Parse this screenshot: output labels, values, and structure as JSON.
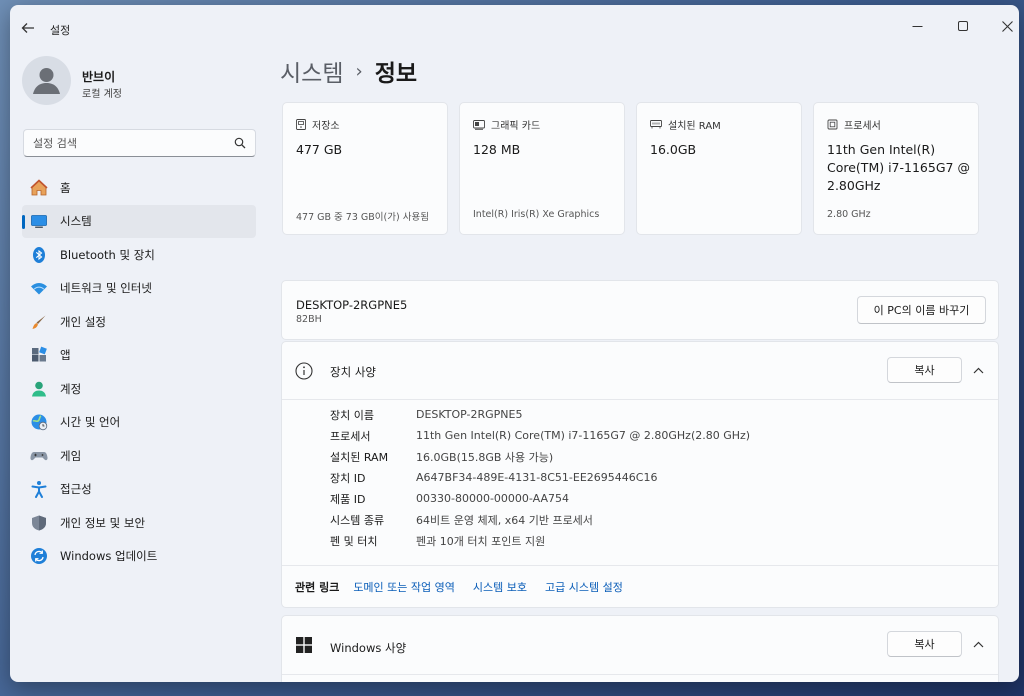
{
  "window": {
    "app_title": "설정"
  },
  "profile": {
    "name": "반브이",
    "account_type": "로컬 계정"
  },
  "search": {
    "placeholder": "설정 검색"
  },
  "nav": {
    "items": [
      {
        "label": "홈",
        "icon": "home-icon"
      },
      {
        "label": "시스템",
        "icon": "system-icon",
        "active": true
      },
      {
        "label": "Bluetooth 및 장치",
        "icon": "bluetooth-icon"
      },
      {
        "label": "네트워크 및 인터넷",
        "icon": "network-icon"
      },
      {
        "label": "개인 설정",
        "icon": "brush-icon"
      },
      {
        "label": "앱",
        "icon": "apps-icon"
      },
      {
        "label": "계정",
        "icon": "account-icon"
      },
      {
        "label": "시간 및 언어",
        "icon": "time-language-icon"
      },
      {
        "label": "게임",
        "icon": "gamepad-icon"
      },
      {
        "label": "접근성",
        "icon": "accessibility-icon"
      },
      {
        "label": "개인 정보 및 보안",
        "icon": "shield-icon"
      },
      {
        "label": "Windows 업데이트",
        "icon": "update-icon"
      }
    ]
  },
  "breadcrumb": {
    "parent": "시스템",
    "separator": "›",
    "current": "정보"
  },
  "cards": [
    {
      "label": "저장소",
      "value": "477 GB",
      "footer": "477 GB 중 73 GB이(가) 사용됨",
      "icon": "storage-icon"
    },
    {
      "label": "그래픽 카드",
      "value": "128 MB",
      "footer": "Intel(R) Iris(R) Xe Graphics",
      "icon": "graphics-card-icon"
    },
    {
      "label": "설치된 RAM",
      "value": "16.0GB",
      "footer": "",
      "icon": "ram-icon"
    },
    {
      "label": "프로세서",
      "value": "11th Gen Intel(R) Core(TM) i7-1165G7 @ 2.80GHz",
      "footer": "2.80 GHz",
      "icon": "processor-icon"
    }
  ],
  "pc": {
    "name": "DESKTOP-2RGPNE5",
    "model": "82BH",
    "rename_label": "이 PC의 이름 바꾸기"
  },
  "device_specs": {
    "title": "장치 사양",
    "copy_label": "복사",
    "rows": [
      {
        "label": "장치 이름",
        "value": "DESKTOP-2RGPNE5"
      },
      {
        "label": "프로세서",
        "value": "11th Gen Intel(R) Core(TM) i7-1165G7 @ 2.80GHz(2.80 GHz)"
      },
      {
        "label": "설치된 RAM",
        "value": "16.0GB(15.8GB 사용 가능)"
      },
      {
        "label": "장치 ID",
        "value": "A647BF34-489E-4131-8C51-EE2695446C16"
      },
      {
        "label": "제품 ID",
        "value": "00330-80000-00000-AA754"
      },
      {
        "label": "시스템 종류",
        "value": "64비트 운영 체제, x64 기반 프로세서"
      },
      {
        "label": "펜 및 터치",
        "value": "펜과 10개 터치 포인트 지원"
      }
    ],
    "related_title": "관련 링크",
    "related_links": [
      "도메인 또는 작업 영역",
      "시스템 보호",
      "고급 시스템 설정"
    ]
  },
  "windows_specs": {
    "title": "Windows 사양",
    "copy_label": "복사"
  },
  "colors": {
    "accent": "#0067c0",
    "link": "#0a5db8"
  }
}
